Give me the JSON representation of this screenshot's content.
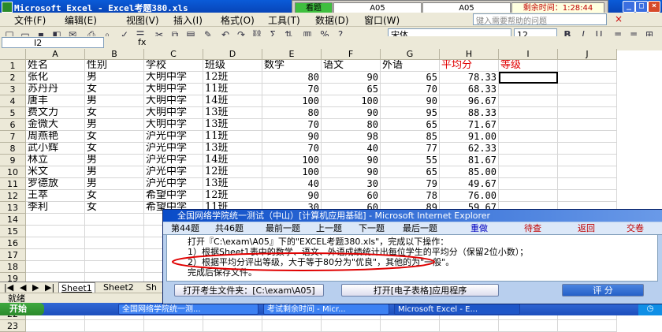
{
  "window": {
    "title": "Microsoft Excel - Excel考题380.xls"
  },
  "exam_strip": {
    "status": "看题",
    "cell1": "A05",
    "cell2": "A05",
    "timer_label": "剩余时间：1:28:44"
  },
  "menu": {
    "items": [
      "文件(F)",
      "编辑(E)",
      "视图(V)",
      "插入(I)",
      "格式(O)",
      "工具(T)",
      "数据(D)",
      "窗口(W)"
    ],
    "search_placeholder": "键入需要帮助的问题"
  },
  "toolbar": {
    "font": "宋体",
    "size": "12"
  },
  "formula_bar": {
    "name_box": "I2",
    "fx": "fx"
  },
  "sheet": {
    "columns": [
      "A",
      "B",
      "C",
      "D",
      "E",
      "F",
      "G",
      "H",
      "I",
      "J"
    ],
    "row_numbers": [
      "1",
      "2",
      "3",
      "4",
      "5",
      "6",
      "7",
      "8",
      "9",
      "10",
      "11",
      "12",
      "13",
      "14",
      "15",
      "16",
      "17",
      "18",
      "19",
      "20",
      "21",
      "22",
      "23"
    ],
    "header": [
      "姓名",
      "性别",
      "学校",
      "班级",
      "数学",
      "语文",
      "外语",
      "平均分",
      "等级"
    ],
    "rows": [
      [
        "张化",
        "男",
        "大明中学",
        "12班",
        "80",
        "90",
        "65",
        "78.33"
      ],
      [
        "苏丹丹",
        "女",
        "大明中学",
        "11班",
        "70",
        "65",
        "70",
        "68.33"
      ],
      [
        "唐丰",
        "男",
        "大明中学",
        "14班",
        "100",
        "100",
        "90",
        "96.67"
      ],
      [
        "费文力",
        "女",
        "大明中学",
        "13班",
        "80",
        "90",
        "95",
        "88.33"
      ],
      [
        "金微大",
        "男",
        "大明中学",
        "13班",
        "70",
        "80",
        "65",
        "71.67"
      ],
      [
        "周燕艳",
        "女",
        "沪光中学",
        "11班",
        "90",
        "98",
        "85",
        "91.00"
      ],
      [
        "武小辉",
        "女",
        "沪光中学",
        "13班",
        "70",
        "40",
        "77",
        "62.33"
      ],
      [
        "林立",
        "男",
        "沪光中学",
        "14班",
        "100",
        "90",
        "55",
        "81.67"
      ],
      [
        "米文",
        "男",
        "沪光中学",
        "12班",
        "100",
        "90",
        "65",
        "85.00"
      ],
      [
        "罗德放",
        "男",
        "沪光中学",
        "13班",
        "40",
        "30",
        "79",
        "49.67"
      ],
      [
        "王萃",
        "女",
        "希望中学",
        "12班",
        "90",
        "60",
        "78",
        "76.00"
      ],
      [
        "李利",
        "女",
        "希望中学",
        "11班",
        "30",
        "60",
        "89",
        "59.67"
      ]
    ]
  },
  "sheet_tabs": [
    "Sheet1",
    "Sheet2",
    "Sh"
  ],
  "status_bar": {
    "text": "就绪"
  },
  "taskbar": {
    "start": "开始",
    "tasks": [
      "全国网络学院统一测...",
      "考试剩余时间 - Micr...",
      "Microsoft Excel - E..."
    ]
  },
  "dialog": {
    "title": "全国网络学院统一测试（中山）[计算机应用基础] - Microsoft Internet Explorer",
    "nav": {
      "current": "第44题",
      "total": "共46题",
      "first": "最前一题",
      "prev": "上一题",
      "next": "下一题",
      "last": "最后一题",
      "redo": "重做",
      "pending": "待查",
      "back": "返回",
      "submit": "交卷"
    },
    "lines": [
      "打开『C:\\exam\\A05』下的\"EXCEL考题380.xls\"，完成以下操作：",
      "1）根据Sheet1表中的数学、语文、外语成绩统计出每位学生的平均分（保留2位小数）；",
      "2）根据平均分评出等级，大于等于80分为\"优良\"，其他的为\"一般\"。",
      "完成后保存文件。"
    ],
    "buttons": {
      "open_folder": "打开考生文件夹：[C:\\exam\\A05]",
      "open_app": "打开[电子表格]应用程序",
      "grade": "评 分"
    }
  },
  "colors": {
    "accent_red": "#e00000",
    "title_blue": "#0a5bd8"
  }
}
